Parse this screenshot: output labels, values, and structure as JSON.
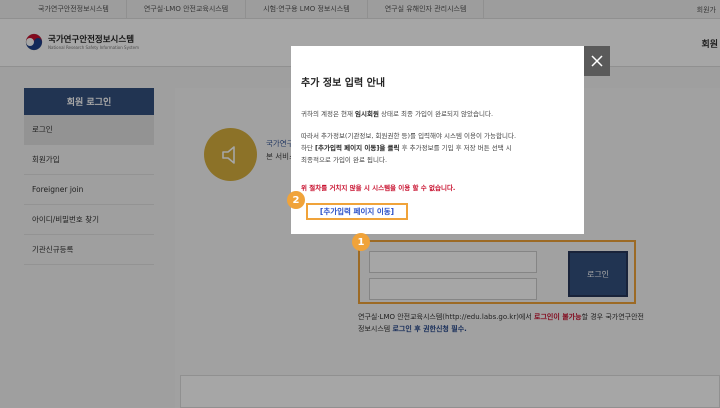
{
  "topbar": {
    "links": [
      "국가연구안전정보시스템",
      "연구실·LMO 안전교육시스템",
      "시험·연구용 LMO 정보시스템",
      "연구실 유해인자 관리시스템"
    ],
    "right": "회원가"
  },
  "header": {
    "logo_title": "국가연구안전정보시스템",
    "logo_subtitle": "National Research Safety Information System",
    "nav_right": "회원"
  },
  "sidebar": {
    "title": "회원 로그인",
    "items": [
      {
        "label": "로그인"
      },
      {
        "label": "회원가입"
      },
      {
        "label": "Foreigner join"
      },
      {
        "label": "아이디/비밀번호 찾기"
      },
      {
        "label": "기관신규등록"
      }
    ]
  },
  "content": {
    "line1": "국가연구",
    "line2": "본 서비스"
  },
  "login": {
    "button_label": "로그인",
    "note_a": "연구실·LMO 안전교육시스템(http://edu.labs.go.kr)에서 ",
    "note_red": "로그인이 불가능",
    "note_b": "할 경우 국가연구안전정보시스템 ",
    "note_blue": "로그인 후 권한신청 필수."
  },
  "badges": {
    "one": "1",
    "two": "2"
  },
  "modal": {
    "title": "추가 정보 입력 안내",
    "p1_a": "귀하의 계정은 현재 ",
    "p1_b": "임시회원",
    "p1_c": " 상태로 최종 가입이 완료되지 않았습니다.",
    "p2_a": "따라서 추가정보(기관정보, 회원권한 등)를 입력해야 시스템 이용이 가능합니다.",
    "p2_b": "하단 ",
    "p2_c": "[추가입력 페이지 이동]을 클릭",
    "p2_d": " 후 추가정보를 기입 후 저장 버튼 선택 시",
    "p2_e": "최종적으로 가입이 완료 됩니다.",
    "warning": "위 절차를 거치지 않을 시 시스템을 이용 할 수 없습니다.",
    "link_label": "[추가입력 페이지 이동]"
  },
  "colors": {
    "primary": "#34507e",
    "accent_orange": "#f0a33a",
    "warning_red": "#c8102e",
    "link_blue": "#2a50c8",
    "speaker_gold": "#d7b03e"
  },
  "icons": {
    "logo": "national-emblem-icon",
    "speaker": "speaker-icon",
    "close": "close-icon"
  }
}
